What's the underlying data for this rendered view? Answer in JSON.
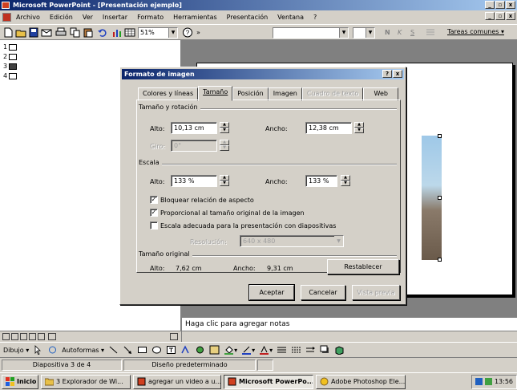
{
  "window": {
    "title": "Microsoft PowerPoint - [Presentación ejemplo]",
    "min": "_",
    "max": "▫",
    "close": "x"
  },
  "menu": [
    "Archivo",
    "Edición",
    "Ver",
    "Insertar",
    "Formato",
    "Herramientas",
    "Presentación",
    "Ventana",
    "?"
  ],
  "toolbar": {
    "zoom": "51%",
    "font": "",
    "size": "",
    "bold": "N",
    "italic": "K",
    "underline": "S",
    "tasks": "Tareas comunes"
  },
  "outline": {
    "slides": [
      {
        "num": "1"
      },
      {
        "num": "2"
      },
      {
        "num": "3"
      },
      {
        "num": "4"
      }
    ]
  },
  "notes": {
    "placeholder": "Haga clic para agregar notas"
  },
  "dialog": {
    "title": "Formato de imagen",
    "help": "?",
    "close": "x",
    "tabs": [
      {
        "label": "Colores y líneas",
        "state": "normal"
      },
      {
        "label": "Tamaño",
        "state": "active"
      },
      {
        "label": "Posición",
        "state": "normal"
      },
      {
        "label": "Imagen",
        "state": "normal"
      },
      {
        "label": "Cuadro de texto",
        "state": "disabled"
      },
      {
        "label": "Web",
        "state": "normal"
      }
    ],
    "size_group": "Tamaño y rotación",
    "alto_label": "Alto:",
    "alto_value": "10,13 cm",
    "ancho_label": "Ancho:",
    "ancho_value": "12,38 cm",
    "giro_label": "Giro:",
    "giro_value": "0°",
    "scale_group": "Escala",
    "scale_alto_label": "Alto:",
    "scale_alto_value": "133 %",
    "scale_ancho_label": "Ancho:",
    "scale_ancho_value": "133 %",
    "lock_aspect": {
      "label": "Bloquear relación de aspecto",
      "checked": true
    },
    "relative_original": {
      "label": "Proporcional al tamaño original de la imagen",
      "checked": true
    },
    "best_scale": {
      "label": "Escala adecuada para la presentación con diapositivas",
      "checked": false
    },
    "resolution_label": "Resolución:",
    "resolution_value": "640 x 480",
    "original_group": "Tamaño original",
    "orig_alto_label": "Alto:",
    "orig_alto_value": "7,62 cm",
    "orig_ancho_label": "Ancho:",
    "orig_ancho_value": "9,31 cm",
    "reset_button": "Restablecer",
    "ok_button": "Aceptar",
    "cancel_button": "Cancelar",
    "preview_button": "Vista previa"
  },
  "drawbar": {
    "draw": "Dibujo",
    "autoshapes": "Autoformas"
  },
  "status": {
    "slide": "Diapositiva 3 de 4",
    "design": "Diseño predeterminado"
  },
  "taskbar": {
    "start": "Inicio",
    "items": [
      {
        "label": "3 Explorador de Wi...",
        "active": false
      },
      {
        "label": "agregar un video a u...",
        "active": false
      },
      {
        "label": "Microsoft PowerPo...",
        "active": true
      },
      {
        "label": "Adobe Photoshop Ele...",
        "active": false
      }
    ],
    "clock": "13:56"
  }
}
